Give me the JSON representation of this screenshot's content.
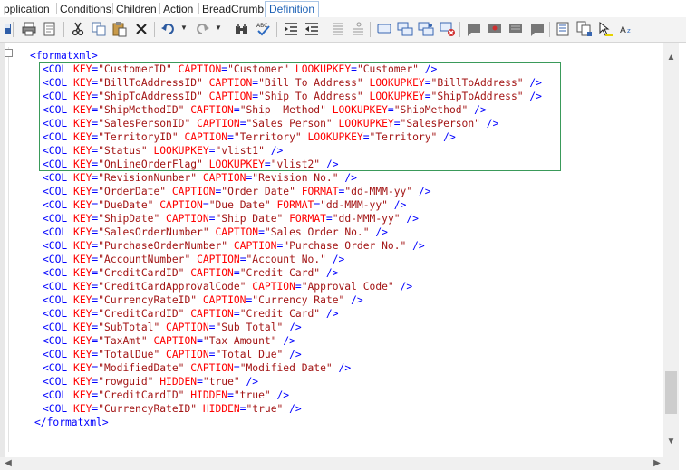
{
  "tabs": [
    {
      "label": "pplication"
    },
    {
      "label": "Conditions"
    },
    {
      "label": "Children"
    },
    {
      "label": "Action"
    },
    {
      "label": "BreadCrumb"
    },
    {
      "label": "Definition"
    }
  ],
  "editor": {
    "root_open": "<formatxml>",
    "root_close": "</formatxml>",
    "lines": [
      {
        "key": "CustomerID",
        "attrs": [
          [
            "CAPTION",
            "Customer"
          ],
          [
            "LOOKUPKEY",
            "Customer"
          ]
        ]
      },
      {
        "key": "BillToAddressID",
        "attrs": [
          [
            "CAPTION",
            "Bill To Address"
          ],
          [
            "LOOKUPKEY",
            "BillToAddress"
          ]
        ]
      },
      {
        "key": "ShipToAddressID",
        "attrs": [
          [
            "CAPTION",
            "Ship To Address"
          ],
          [
            "LOOKUPKEY",
            "ShipToAddress"
          ]
        ]
      },
      {
        "key": "ShipMethodID",
        "attrs": [
          [
            "CAPTION",
            "Ship  Method"
          ],
          [
            "LOOKUPKEY",
            "ShipMethod"
          ]
        ]
      },
      {
        "key": "SalesPersonID",
        "attrs": [
          [
            "CAPTION",
            "Sales Person"
          ],
          [
            "LOOKUPKEY",
            "SalesPerson"
          ]
        ]
      },
      {
        "key": "TerritoryID",
        "attrs": [
          [
            "CAPTION",
            "Territory"
          ],
          [
            "LOOKUPKEY",
            "Territory"
          ]
        ]
      },
      {
        "key": "Status",
        "attrs": [
          [
            "LOOKUPKEY",
            "vlist1"
          ]
        ]
      },
      {
        "key": "OnLineOrderFlag",
        "attrs": [
          [
            "LOOKUPKEY",
            "vlist2"
          ]
        ]
      },
      {
        "key": "RevisionNumber",
        "attrs": [
          [
            "CAPTION",
            "Revision No."
          ]
        ]
      },
      {
        "key": "OrderDate",
        "attrs": [
          [
            "CAPTION",
            "Order Date"
          ],
          [
            "FORMAT",
            "dd-MMM-yy"
          ]
        ]
      },
      {
        "key": "DueDate",
        "attrs": [
          [
            "CAPTION",
            "Due Date"
          ],
          [
            "FORMAT",
            "dd-MMM-yy"
          ]
        ]
      },
      {
        "key": "ShipDate",
        "attrs": [
          [
            "CAPTION",
            "Ship Date"
          ],
          [
            "FORMAT",
            "dd-MMM-yy"
          ]
        ]
      },
      {
        "key": "SalesOrderNumber",
        "attrs": [
          [
            "CAPTION",
            "Sales Order No."
          ]
        ]
      },
      {
        "key": "PurchaseOrderNumber",
        "attrs": [
          [
            "CAPTION",
            "Purchase Order No."
          ]
        ]
      },
      {
        "key": "AccountNumber",
        "attrs": [
          [
            "CAPTION",
            "Account No."
          ]
        ]
      },
      {
        "key": "CreditCardID",
        "attrs": [
          [
            "CAPTION",
            "Credit Card"
          ]
        ]
      },
      {
        "key": "CreditCardApprovalCode",
        "attrs": [
          [
            "CAPTION",
            "Approval Code"
          ]
        ]
      },
      {
        "key": "CurrencyRateID",
        "attrs": [
          [
            "CAPTION",
            "Currency Rate"
          ]
        ]
      },
      {
        "key": "CreditCardID",
        "attrs": [
          [
            "CAPTION",
            "Credit Card"
          ]
        ]
      },
      {
        "key": "SubTotal",
        "attrs": [
          [
            "CAPTION",
            "Sub Total"
          ]
        ]
      },
      {
        "key": "TaxAmt",
        "attrs": [
          [
            "CAPTION",
            "Tax Amount"
          ]
        ]
      },
      {
        "key": "TotalDue",
        "attrs": [
          [
            "CAPTION",
            "Total Due"
          ]
        ]
      },
      {
        "key": "ModifiedDate",
        "attrs": [
          [
            "CAPTION",
            "Modified Date"
          ]
        ]
      },
      {
        "key": "rowguid",
        "attrs": [
          [
            "HIDDEN",
            "true"
          ]
        ]
      },
      {
        "key": "CreditCardID",
        "attrs": [
          [
            "HIDDEN",
            "true"
          ]
        ]
      },
      {
        "key": "CurrencyRateID",
        "attrs": [
          [
            "HIDDEN",
            "true"
          ]
        ]
      }
    ]
  },
  "toolbar": {
    "icons": [
      "save-icon",
      "print-icon",
      "cut-icon",
      "copy-icon",
      "paste-icon",
      "delete-icon",
      "undo-icon",
      "redo-icon",
      "find-icon",
      "spellcheck-icon",
      "indent-icon",
      "outdent-icon",
      "numbered-list-icon",
      "bulleted-list-icon",
      "comment-icon",
      "add-comment-icon",
      "reply-comment-icon",
      "delete-comment-icon",
      "previous-comment-icon",
      "next-comment-icon",
      "comments-icon",
      "track-changes-icon",
      "preview-icon",
      "copy-doc-icon",
      "highlight-icon",
      "font-size-icon"
    ]
  },
  "colors": {
    "tag": "#0000ff",
    "attribute": "#ff0000",
    "value": "#a31515",
    "highlight_border": "#3a9a5a",
    "active_tab": "#1a5fb4"
  }
}
